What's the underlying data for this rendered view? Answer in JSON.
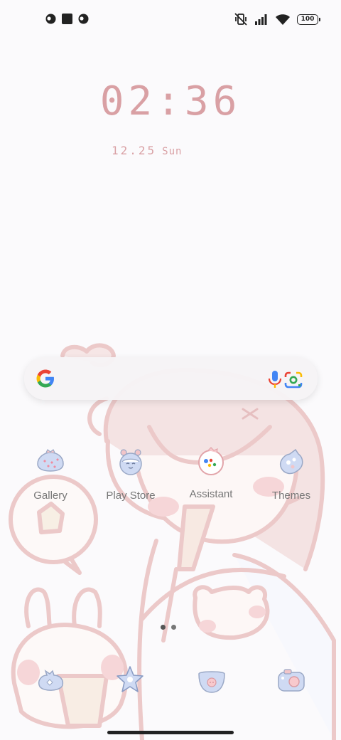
{
  "status_bar": {
    "battery_level": "100",
    "left_icons": [
      "notification-icon",
      "square-app-icon",
      "notification-icon"
    ],
    "right_icons": [
      "vibrate-off-icon",
      "signal-icon",
      "wifi-icon",
      "battery-icon"
    ]
  },
  "clock": {
    "time": "02:36",
    "date": "12.25",
    "day": "Sun"
  },
  "search_bar": {
    "icons": [
      "google-icon",
      "mic-icon",
      "lens-icon"
    ]
  },
  "apps": [
    {
      "label": "Gallery",
      "icon": "gallery-icon"
    },
    {
      "label": "Play Store",
      "icon": "play-store-icon"
    },
    {
      "label": "Assistant",
      "icon": "assistant-icon"
    },
    {
      "label": "Themes",
      "icon": "themes-icon"
    }
  ],
  "dock": [
    {
      "icon": "phone-icon"
    },
    {
      "icon": "star-icon"
    },
    {
      "icon": "messages-icon"
    },
    {
      "icon": "camera-icon"
    }
  ],
  "page_indicator": {
    "pages": 2,
    "current": 1
  },
  "colors": {
    "clock_text": "#d9a0a4",
    "wallpaper_line": "#e6bfc0",
    "accent_blue": "#c9d6f2"
  }
}
